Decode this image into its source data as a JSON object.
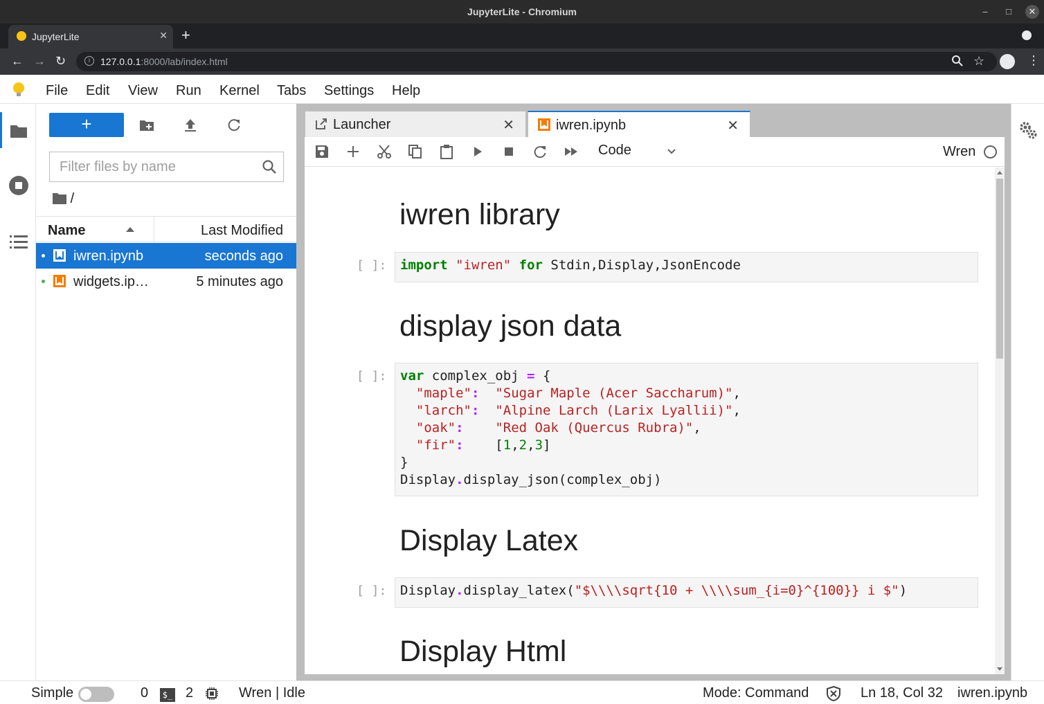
{
  "window": {
    "title": "JupyterLite - Chromium"
  },
  "browser": {
    "tab_title": "JupyterLite",
    "url_host": "127.0.0.1",
    "url_rest": ":8000/lab/index.html"
  },
  "menu": {
    "items": [
      "File",
      "Edit",
      "View",
      "Run",
      "Kernel",
      "Tabs",
      "Settings",
      "Help"
    ]
  },
  "filebrowser": {
    "new_label": "+",
    "filter_placeholder": "Filter files by name",
    "breadcrumb": "/",
    "col_name": "Name",
    "col_modified": "Last Modified",
    "files": [
      {
        "name": "iwren.ipynb",
        "modified": "seconds ago",
        "active": true
      },
      {
        "name": "widgets.ip…",
        "modified": "5 minutes ago",
        "active": false
      }
    ]
  },
  "tabs": [
    {
      "label": "Launcher",
      "current": false
    },
    {
      "label": "iwren.ipynb",
      "current": true
    }
  ],
  "notebook": {
    "cell_type": "Code",
    "kernel_name": "Wren",
    "prompt": "[ ]:",
    "headings": [
      "iwren library",
      "display json data",
      "Display Latex",
      "Display Html"
    ]
  },
  "statusbar": {
    "mode_simple": "Simple",
    "terminals": "0",
    "kernels": "2",
    "kernel_status": "Wren | Idle",
    "mode": "Mode: Command",
    "position": "Ln 18, Col 32",
    "filename": "iwren.ipynb"
  },
  "colors": {
    "accent": "#1976d2",
    "notebook_icon": "#f57c00",
    "keyword": "#008000",
    "string": "#ba2121",
    "operator": "#aa22ff"
  }
}
